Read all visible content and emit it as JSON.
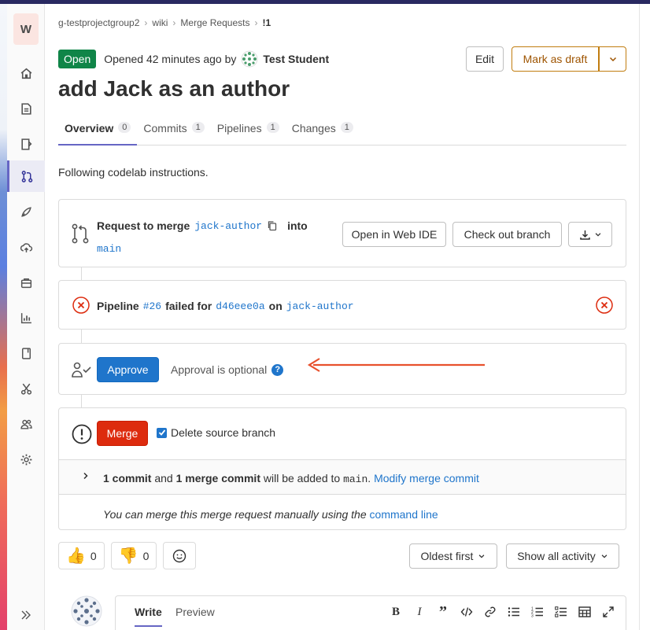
{
  "sidebar": {
    "avatar_letter": "W",
    "items": [
      "home-icon",
      "issues-icon",
      "repository-icon",
      "merge-requests-icon",
      "ci-cd-icon",
      "deployments-icon",
      "packages-icon",
      "analytics-icon",
      "wiki-icon",
      "snippets-icon",
      "members-icon",
      "settings-icon"
    ],
    "active": "merge-requests-icon"
  },
  "breadcrumb": [
    "g-testprojectgroup2",
    "wiki",
    "Merge Requests",
    "!1"
  ],
  "header": {
    "status": "Open",
    "opened_text": "Opened 42 minutes ago by",
    "author": "Test Student",
    "edit_label": "Edit",
    "draft_label": "Mark as draft"
  },
  "title": "add Jack as an author",
  "tabs": [
    {
      "label": "Overview",
      "count": "0"
    },
    {
      "label": "Commits",
      "count": "1"
    },
    {
      "label": "Pipelines",
      "count": "1"
    },
    {
      "label": "Changes",
      "count": "1"
    }
  ],
  "description": "Following codelab instructions.",
  "request": {
    "prefix": "Request to merge",
    "source_branch": "jack-author",
    "into": "into",
    "target_branch": "main",
    "web_ide_label": "Open in Web IDE",
    "checkout_label": "Check out branch"
  },
  "pipeline": {
    "label": "Pipeline",
    "id": "#26",
    "failed_for": "failed for",
    "commit": "d46eee0a",
    "on": "on",
    "branch": "jack-author"
  },
  "approval": {
    "button": "Approve",
    "text": "Approval is optional"
  },
  "merge": {
    "button": "Merge",
    "delete_branch_label": "Delete source branch",
    "delete_branch_checked": true,
    "commit_count": "1 commit",
    "and": "and",
    "merge_commit": "1 merge commit",
    "added_to": "will be added to",
    "target": "main",
    "modify_link": "Modify merge commit",
    "manual_text": "You can merge this merge request manually using the",
    "command_line": "command line"
  },
  "reactions": {
    "thumbs_up": "0",
    "thumbs_down": "0"
  },
  "activity": {
    "sort_label": "Oldest first",
    "filter_label": "Show all activity"
  },
  "editor": {
    "write_tab": "Write",
    "preview_tab": "Preview"
  },
  "colors": {
    "accent": "#6666c4",
    "open_badge": "#108548",
    "approve": "#1f75cb",
    "merge": "#dd2b0e",
    "failed": "#dd2b0e",
    "arrow": "#e8512d",
    "draft": "#c17d10"
  }
}
